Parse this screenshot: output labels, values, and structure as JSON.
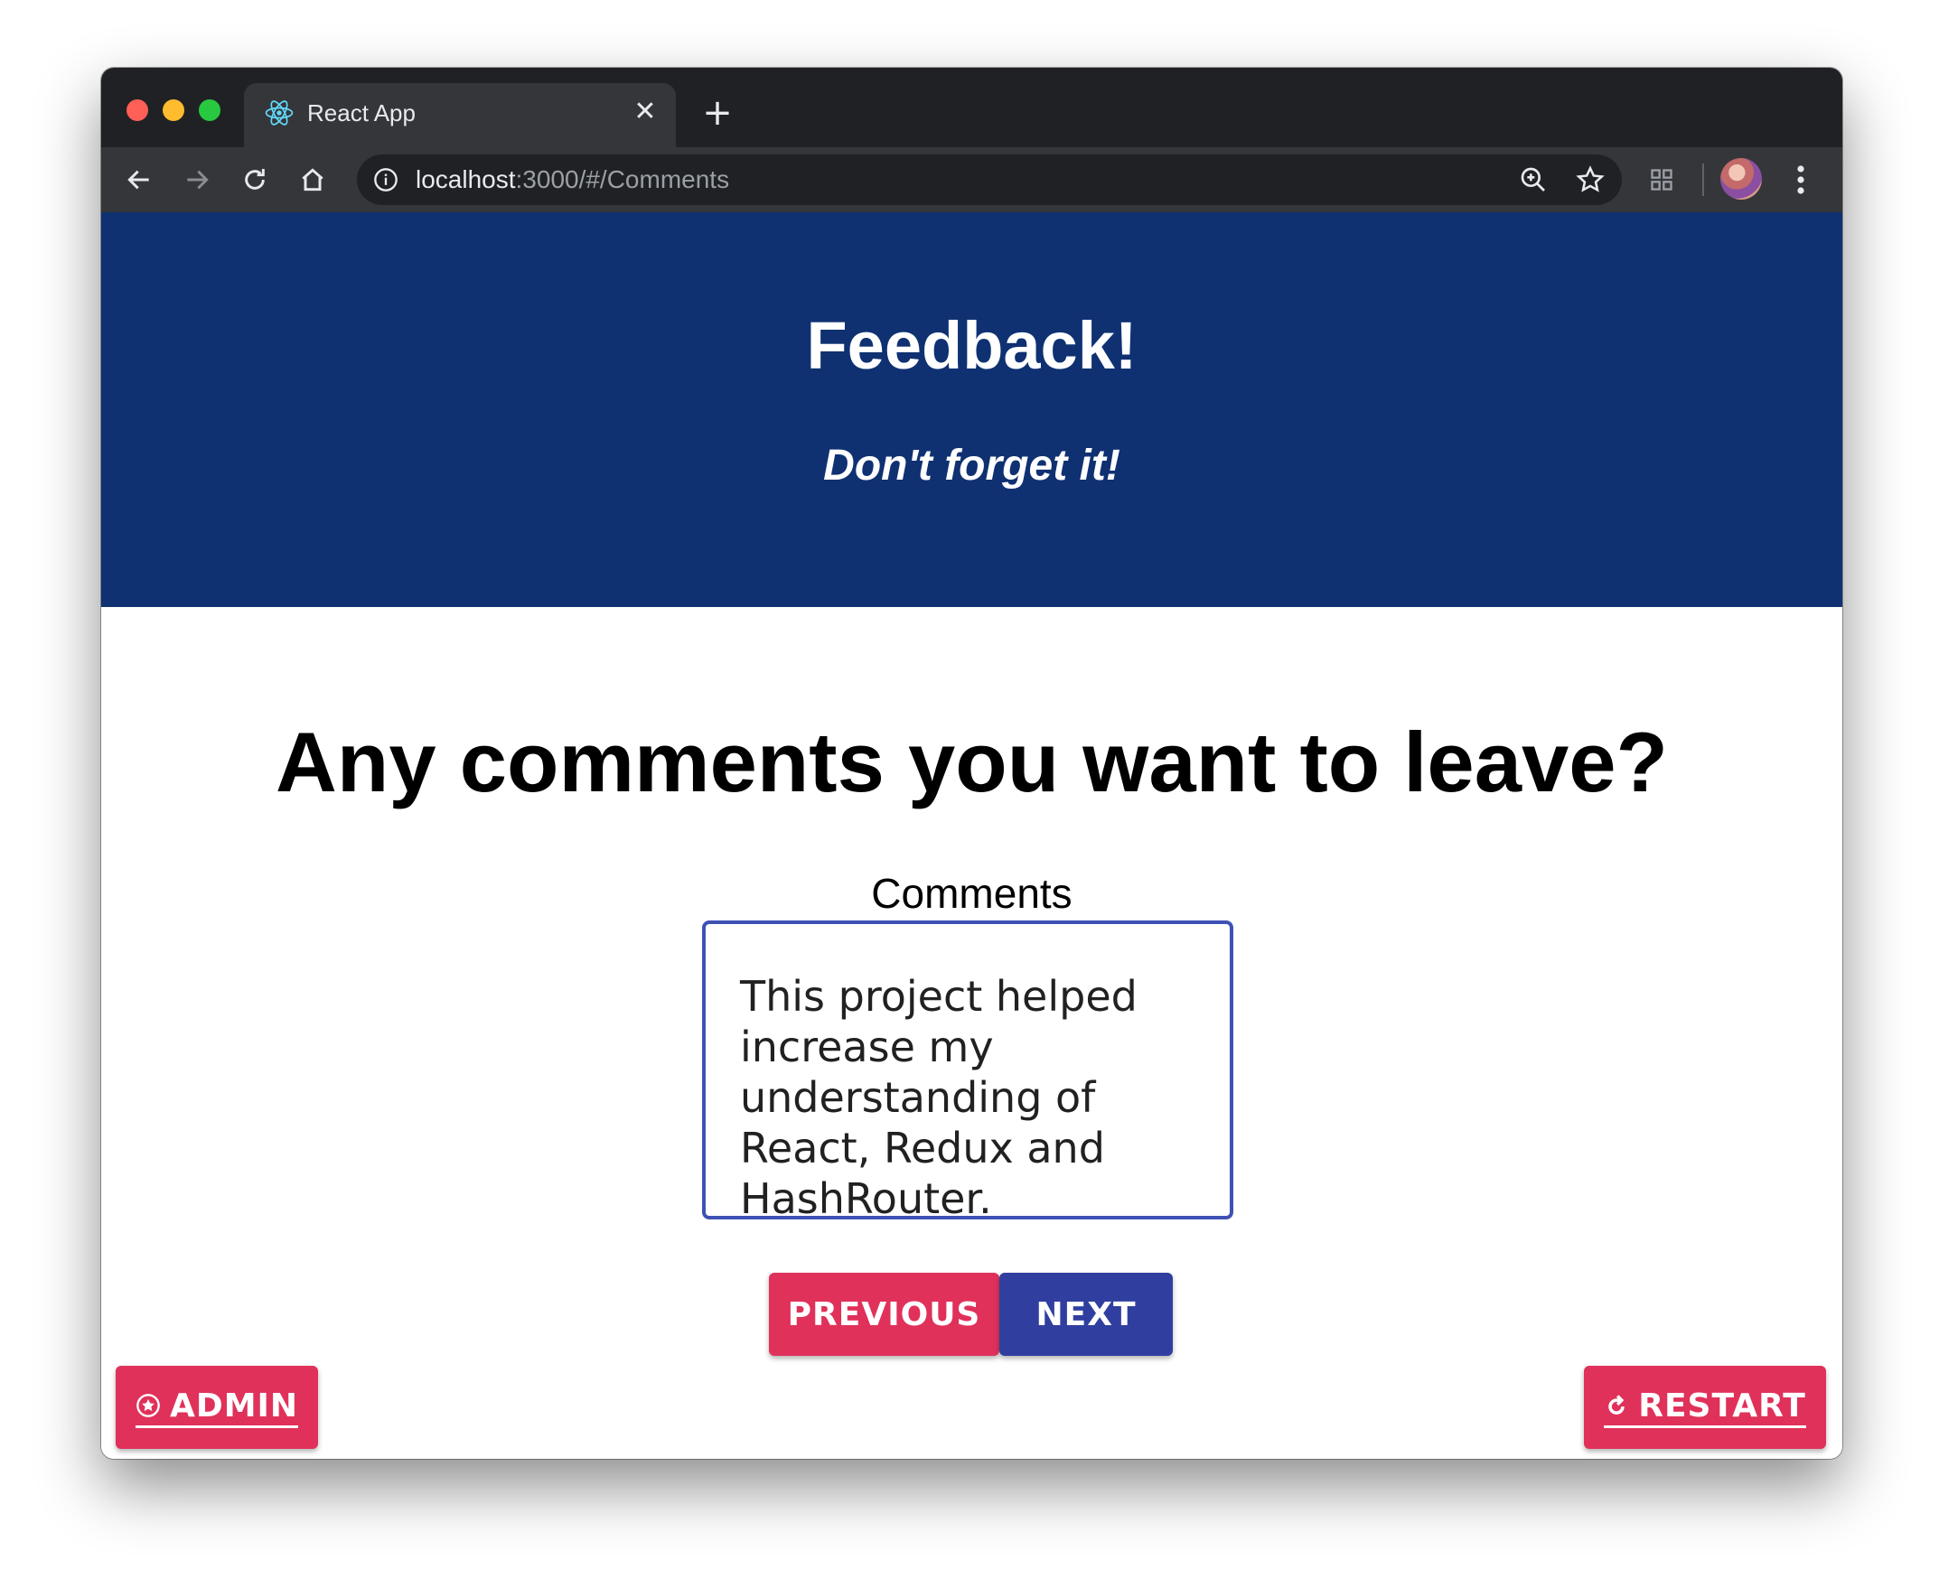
{
  "browser": {
    "tab_title": "React App",
    "url_host": "localhost",
    "url_rest": ":3000/#/Comments",
    "icons": {
      "tab_favicon": "react-logo-icon",
      "tab_close": "close-icon",
      "new_tab": "plus-icon",
      "back": "arrow-left-icon",
      "forward": "arrow-right-icon",
      "reload": "reload-icon",
      "home": "home-icon",
      "site_info": "info-icon",
      "zoom": "zoom-icon",
      "bookmark": "star-icon",
      "extensions": "grid-icon",
      "profile": "avatar",
      "menu": "kebab-menu-icon"
    }
  },
  "header": {
    "title": "Feedback!",
    "subtitle": "Don't forget it!",
    "background": "#0f3172"
  },
  "main": {
    "question": "Any comments you want to leave?",
    "comments_label": "Comments",
    "comments_value": "This project helped increase my understanding of React, Redux and HashRouter."
  },
  "buttons": {
    "previous": "PREVIOUS",
    "next": "NEXT",
    "admin": "ADMIN",
    "restart": "RESTART"
  },
  "colors": {
    "primary_pink": "#e0315b",
    "primary_indigo": "#303f9f",
    "field_border": "#3f51b5"
  }
}
